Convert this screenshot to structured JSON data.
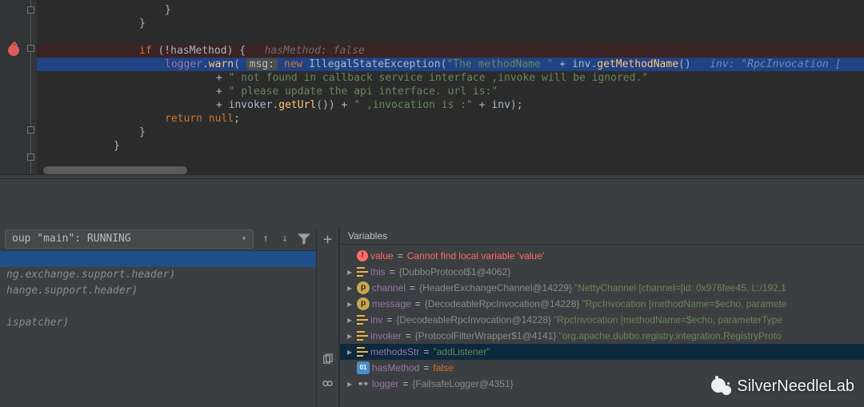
{
  "editor": {
    "lines": [
      {
        "indent": 160,
        "segs": [
          {
            "t": "}",
            "c": "ident"
          }
        ]
      },
      {
        "indent": 128,
        "segs": [
          {
            "t": "}",
            "c": "ident"
          }
        ]
      },
      {
        "indent": 128,
        "segs": []
      },
      {
        "indent": 128,
        "bp": true,
        "segs": [
          {
            "t": "if ",
            "c": "kw"
          },
          {
            "t": "(!",
            "c": "ident"
          },
          {
            "t": "hasMethod",
            "c": "ident"
          },
          {
            "t": ") {   ",
            "c": "ident"
          },
          {
            "t": "hasMethod: false",
            "c": "inlhint"
          }
        ]
      },
      {
        "indent": 160,
        "hl": true,
        "segs": [
          {
            "t": "logger",
            "c": "field"
          },
          {
            "t": ".",
            "c": "ident"
          },
          {
            "t": "warn",
            "c": "method"
          },
          {
            "t": "( ",
            "c": "ident"
          },
          {
            "t": "msg:",
            "c": "label-pill"
          },
          {
            "t": " ",
            "c": "ident"
          },
          {
            "t": "new ",
            "c": "kw"
          },
          {
            "t": "IllegalStateException",
            "c": "type"
          },
          {
            "t": "(",
            "c": "ident"
          },
          {
            "t": "\"The methodName \"",
            "c": "str"
          },
          {
            "t": " + inv.",
            "c": "ident"
          },
          {
            "t": "getMethodName",
            "c": "method"
          },
          {
            "t": "()   ",
            "c": "ident"
          },
          {
            "t": "inv: \"RpcInvocation [",
            "c": "inlhintblue"
          }
        ]
      },
      {
        "indent": 224,
        "segs": [
          {
            "t": "+ ",
            "c": "ident"
          },
          {
            "t": "\" not found in callback service interface ,invoke will be ignored.\"",
            "c": "str"
          }
        ]
      },
      {
        "indent": 224,
        "segs": [
          {
            "t": "+ ",
            "c": "ident"
          },
          {
            "t": "\" please update the api interface. url is:\"",
            "c": "str"
          }
        ]
      },
      {
        "indent": 224,
        "segs": [
          {
            "t": "+ invoker.",
            "c": "ident"
          },
          {
            "t": "getUrl",
            "c": "method"
          },
          {
            "t": "()) + ",
            "c": "ident"
          },
          {
            "t": "\" ,invocation is :\"",
            "c": "str"
          },
          {
            "t": " + inv);",
            "c": "ident"
          }
        ]
      },
      {
        "indent": 160,
        "segs": [
          {
            "t": "return null",
            "c": "kw"
          },
          {
            "t": ";",
            "c": "ident"
          }
        ]
      },
      {
        "indent": 128,
        "segs": [
          {
            "t": "}",
            "c": "ident"
          }
        ]
      },
      {
        "indent": 96,
        "segs": [
          {
            "t": "}",
            "c": "ident"
          }
        ]
      }
    ]
  },
  "frames": {
    "thread_label": "oup \"main\": RUNNING",
    "rows": [
      {
        "text": "",
        "sel": true
      },
      {
        "text": "ng.exchange.support.header)"
      },
      {
        "text": "hange.support.header)"
      },
      {
        "text": ""
      },
      {
        "text": "ispatcher)"
      }
    ]
  },
  "toolbar": {
    "plus": "+",
    "copy": "copy",
    "link": "link"
  },
  "variables": {
    "title": "Variables",
    "rows": [
      {
        "tw": false,
        "kind": "err",
        "name": "value",
        "eq": " = ",
        "valClass": "err",
        "val": "Cannot find local variable 'value'"
      },
      {
        "tw": true,
        "kind": "bars",
        "name": "this",
        "eq": " = ",
        "valClass": "vgrey",
        "val": "{DubboProtocol$1@4062}"
      },
      {
        "tw": true,
        "kind": "p",
        "name": "channel",
        "eq": " = ",
        "valClass": "vgrey",
        "val": "{HeaderExchangeChannel@14229}",
        "str": " \"NettyChannel [channel=[id: 0x976fee45, L:/192.1"
      },
      {
        "tw": true,
        "kind": "p",
        "name": "message",
        "eq": " = ",
        "valClass": "vgrey",
        "val": "{DecodeableRpcInvocation@14228}",
        "str": " \"RpcInvocation [methodName=$echo, paramete"
      },
      {
        "tw": true,
        "kind": "bars",
        "name": "inv",
        "eq": " = ",
        "valClass": "vgrey",
        "val": "{DecodeableRpcInvocation@14228}",
        "str": " \"RpcInvocation [methodName=$echo, parameterType"
      },
      {
        "tw": true,
        "kind": "bars",
        "name": "invoker",
        "eq": " = ",
        "valClass": "vgrey",
        "val": "{ProtocolFilterWrapper$1@4141}",
        "str": " \"org.apache.dubbo.registry.integration.RegistryProto"
      },
      {
        "tw": true,
        "kind": "bars",
        "sel": true,
        "name": "methodsStr",
        "eq": " = ",
        "valClass": "vstr",
        "val": "\"addListener\""
      },
      {
        "tw": false,
        "kind": "ol",
        "name": "hasMethod",
        "eq": " = ",
        "valClass": "vkw",
        "val": "false"
      },
      {
        "tw": true,
        "kind": "glasses",
        "name": "logger",
        "eq": " = ",
        "valClass": "vgrey",
        "val": "{FailsafeLogger@4351}"
      }
    ]
  },
  "watermark": "SilverNeedleLab"
}
